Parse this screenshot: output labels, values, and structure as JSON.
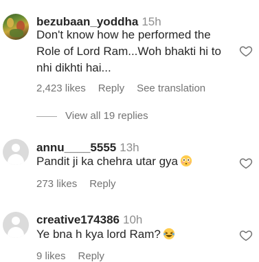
{
  "comments": [
    {
      "username": "bezubaan_yoddha",
      "time": "15h",
      "text": "Don't know how he performed the Role of Lord Ram...Woh bhakti hi to nhi dikhti hai...",
      "likes": "2,423 likes",
      "reply_label": "Reply",
      "translation_label": "See translation",
      "view_replies": "View all 19 replies"
    },
    {
      "username": "annu____5555",
      "time": "13h",
      "text": "Pandit ji ka chehra utar gya",
      "emoji": "flushed-face",
      "likes": "273 likes",
      "reply_label": "Reply"
    },
    {
      "username": "creative174386",
      "time": "10h",
      "text": "Ye bna h kya lord Ram?",
      "emoji": "laughing-face",
      "likes": "9 likes",
      "reply_label": "Reply"
    }
  ],
  "icons": {
    "like": "heart-outline-icon"
  },
  "colors": {
    "text": "#262626",
    "secondary": "#737373",
    "avatar_default": "#dbdbdb"
  }
}
